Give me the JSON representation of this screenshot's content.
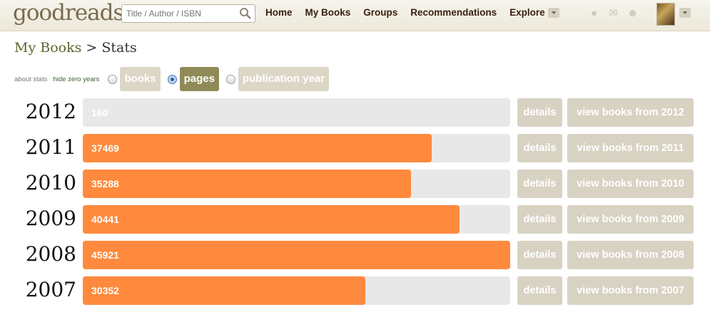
{
  "header": {
    "logo": "goodreads",
    "search": {
      "placeholder": "Title / Author / ISBN",
      "value": ""
    },
    "nav": {
      "home": "Home",
      "my_books": "My Books",
      "groups": "Groups",
      "recommendations": "Recommendations",
      "explore": "Explore"
    },
    "icons": [
      "notifications-icon",
      "messages-icon",
      "friends-icon"
    ]
  },
  "breadcrumb": {
    "parent": "My Books",
    "separator": " > ",
    "current": "Stats"
  },
  "options": {
    "about_stats": "about stats",
    "hide_zero_years": "hide zero years",
    "modes": [
      {
        "label": "books",
        "selected": false
      },
      {
        "label": "pages",
        "selected": true
      },
      {
        "label": "publication year",
        "selected": false
      }
    ]
  },
  "stats": {
    "max_value": 45921,
    "rows": [
      {
        "year": "2012",
        "value": 160,
        "count_label": "160",
        "details": "details",
        "view": "view books from 2012"
      },
      {
        "year": "2011",
        "value": 37469,
        "count_label": "37469",
        "details": "details",
        "view": "view books from 2011"
      },
      {
        "year": "2010",
        "value": 35288,
        "count_label": "35288",
        "details": "details",
        "view": "view books from 2010"
      },
      {
        "year": "2009",
        "value": 40441,
        "count_label": "40441",
        "details": "details",
        "view": "view books from 2009"
      },
      {
        "year": "2008",
        "value": 45921,
        "count_label": "45921",
        "details": "details",
        "view": "view books from 2008"
      },
      {
        "year": "2007",
        "value": 30352,
        "count_label": "30352",
        "details": "details",
        "view": "view books from 2007"
      }
    ]
  },
  "colors": {
    "bar_fill": "#ff8a3d",
    "bar_track": "#e8e8e8",
    "button_bg": "#d8d2c3",
    "active_pill": "#8f8a58"
  }
}
